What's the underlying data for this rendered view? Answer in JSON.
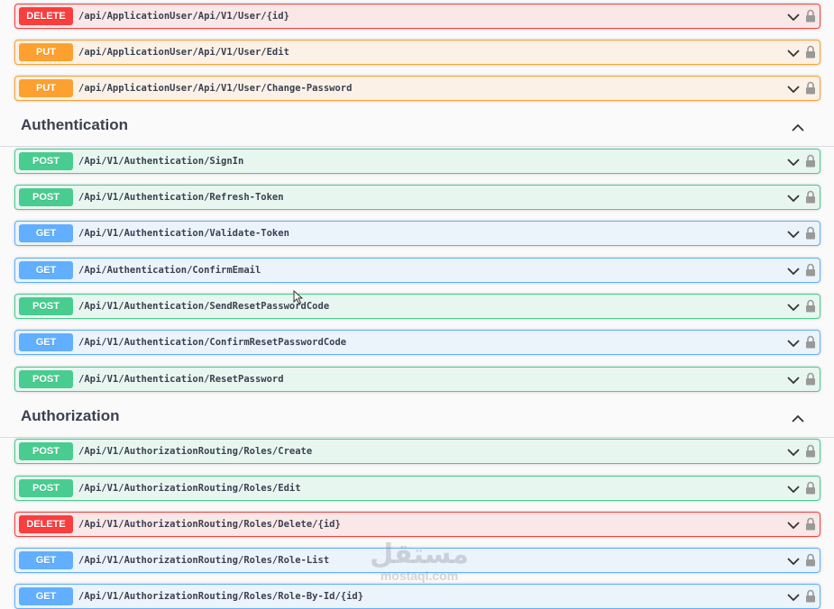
{
  "sections": [
    {
      "title": "",
      "collapse_icon": "chevron-up-icon",
      "operations": [
        {
          "method": "DELETE",
          "path": "/api/ApplicationUser/Api/V1/User/{id}"
        },
        {
          "method": "PUT",
          "path": "/api/ApplicationUser/Api/V1/User/Edit"
        },
        {
          "method": "PUT",
          "path": "/api/ApplicationUser/Api/V1/User/Change-Password"
        }
      ]
    },
    {
      "title": "Authentication",
      "collapse_icon": "chevron-up-icon",
      "operations": [
        {
          "method": "POST",
          "path": "/Api/V1/Authentication/SignIn"
        },
        {
          "method": "POST",
          "path": "/Api/V1/Authentication/Refresh-Token"
        },
        {
          "method": "GET",
          "path": "/Api/V1/Authentication/Validate-Token"
        },
        {
          "method": "GET",
          "path": "/Api/Authentication/ConfirmEmail"
        },
        {
          "method": "POST",
          "path": "/Api/V1/Authentication/SendResetPasswordCode"
        },
        {
          "method": "GET",
          "path": "/Api/V1/Authentication/ConfirmResetPasswordCode"
        },
        {
          "method": "POST",
          "path": "/Api/V1/Authentication/ResetPassword"
        }
      ]
    },
    {
      "title": "Authorization",
      "collapse_icon": "chevron-up-icon",
      "operations": [
        {
          "method": "POST",
          "path": "/Api/V1/AuthorizationRouting/Roles/Create"
        },
        {
          "method": "POST",
          "path": "/Api/V1/AuthorizationRouting/Roles/Edit"
        },
        {
          "method": "DELETE",
          "path": "/Api/V1/AuthorizationRouting/Roles/Delete/{id}"
        },
        {
          "method": "GET",
          "path": "/Api/V1/AuthorizationRouting/Roles/Role-List"
        },
        {
          "method": "GET",
          "path": "/Api/V1/AuthorizationRouting/Roles/Role-By-Id/{id}"
        }
      ]
    }
  ],
  "icons": {
    "expand": "chevron-down-icon",
    "lock": "lock-icon",
    "cursor": "mouse-cursor-icon"
  },
  "colors": {
    "get": "#61affe",
    "post": "#49cc90",
    "put": "#fca130",
    "delete": "#f93e3e",
    "text": "#3b4151"
  },
  "watermark": {
    "arabic": "مستقل",
    "latin": "mostaql.com"
  }
}
